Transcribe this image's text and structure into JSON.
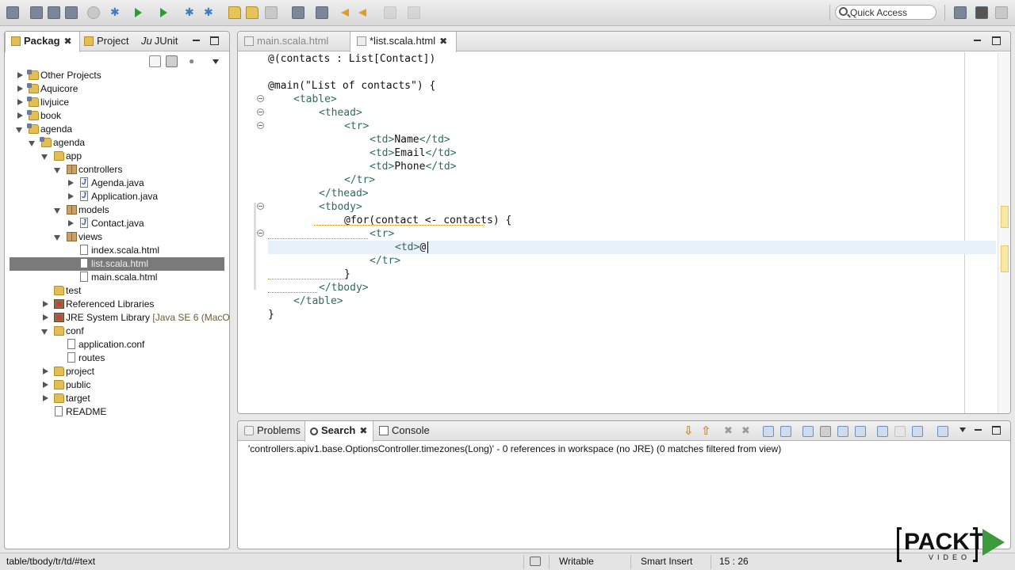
{
  "toolbar": {
    "quick_access_placeholder": "Quick Access"
  },
  "package_explorer": {
    "tabs": [
      {
        "label": "Packag",
        "active": true
      },
      {
        "label": "Project"
      },
      {
        "label": "JUnit",
        "prefix": "Ju"
      }
    ],
    "tree": [
      {
        "label": "Other Projects"
      },
      {
        "label": "Aquicore"
      },
      {
        "label": "livjuice"
      },
      {
        "label": "book"
      },
      {
        "label": "agenda"
      },
      {
        "label": "agenda"
      },
      {
        "label": "app"
      },
      {
        "label": "controllers"
      },
      {
        "label": "Agenda.java"
      },
      {
        "label": "Application.java"
      },
      {
        "label": "models"
      },
      {
        "label": "Contact.java"
      },
      {
        "label": "views"
      },
      {
        "label": "index.scala.html"
      },
      {
        "label": "list.scala.html"
      },
      {
        "label": "main.scala.html"
      },
      {
        "label": "test"
      },
      {
        "label": "Referenced Libraries"
      },
      {
        "label": "JRE System Library",
        "suffix": "[Java SE 6 (MacOS )"
      },
      {
        "label": "conf"
      },
      {
        "label": "application.conf"
      },
      {
        "label": "routes"
      },
      {
        "label": "project"
      },
      {
        "label": "public"
      },
      {
        "label": "target"
      },
      {
        "label": "README"
      }
    ]
  },
  "editor": {
    "tabs": [
      {
        "label": "main.scala.html"
      },
      {
        "label": "*list.scala.html",
        "active": true
      }
    ],
    "code": [
      {
        "pre": "@(contacts : List[Contact])"
      },
      {
        "pre": ""
      },
      {
        "pre": "@main(\"List of contacts\") {"
      },
      {
        "tag_open": "<table>"
      },
      {
        "tag_open": "<thead>"
      },
      {
        "tag_open": "<tr>"
      },
      {
        "tag_open": "<td>",
        "text": "Name",
        "tag_close": "</td>"
      },
      {
        "tag_open": "<td>",
        "text": "Email",
        "tag_close": "</td>"
      },
      {
        "tag_open": "<td>",
        "text": "Phone",
        "tag_close": "</td>"
      },
      {
        "tag_open": "</tr>"
      },
      {
        "tag_open": "</thead>"
      },
      {
        "tag_open": "<tbody>"
      },
      {
        "pre": "@for(contact <- contacts) {"
      },
      {
        "tag_open": "<tr>"
      },
      {
        "tag_open": "<td>",
        "text": "@"
      },
      {
        "tag_open": "</tr>"
      },
      {
        "pre": "}"
      },
      {
        "tag_open": "</tbody>"
      },
      {
        "tag_open": "</table>"
      },
      {
        "pre": "}"
      }
    ]
  },
  "bottom_panel": {
    "tabs": [
      {
        "label": "Problems"
      },
      {
        "label": "Search",
        "active": true
      },
      {
        "label": "Console"
      }
    ],
    "result": "'controllers.apiv1.base.OptionsController.timezones(Long)' - 0 references in workspace (no JRE) (0 matches filtered from view)"
  },
  "statusbar": {
    "path": "table/tbody/tr/td/#text",
    "writable": "Writable",
    "insert_mode": "Smart Insert",
    "position": "15 : 26"
  },
  "logo": {
    "word": "PACKT",
    "sub": "VIDEO"
  },
  "colors": {
    "selection": "#7a7a7a",
    "current_line": "#e8f0fa",
    "tag": "#2b6d5e",
    "logo_play": "#3c9a3c"
  }
}
